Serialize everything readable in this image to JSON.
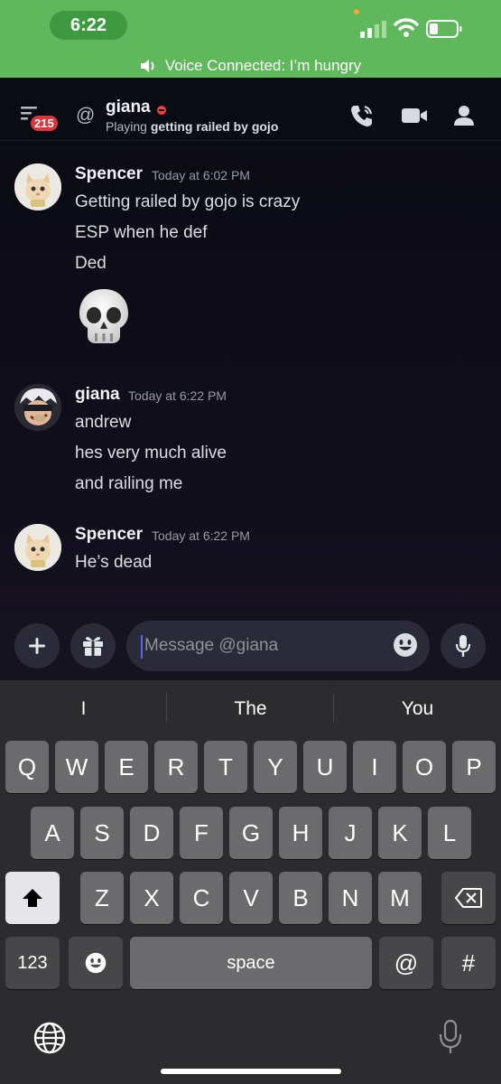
{
  "status_bar": {
    "time": "6:22",
    "voice_banner": "Voice Connected: I’m hungry"
  },
  "header": {
    "unread_badge": "215",
    "at_symbol": "@",
    "username": "giana",
    "status_prefix": "Playing",
    "status_game": "getting railed by gojo"
  },
  "messages": [
    {
      "author": "Spencer",
      "timestamp": "Today at 6:02 PM",
      "lines": [
        "Getting railed by gojo is crazy",
        "ESP when he def",
        "Ded"
      ],
      "emoji": "skull-emoji"
    },
    {
      "author": "giana",
      "timestamp": "Today at 6:22 PM",
      "lines": [
        "andrew",
        "hes very much alive",
        "and railing me"
      ]
    },
    {
      "author": "Spencer",
      "timestamp": "Today at 6:22 PM",
      "lines": [
        "He’s dead"
      ]
    }
  ],
  "composer": {
    "placeholder": "Message @giana"
  },
  "keyboard": {
    "suggestions": [
      "I",
      "The",
      "You"
    ],
    "row1": [
      "Q",
      "W",
      "E",
      "R",
      "T",
      "Y",
      "U",
      "I",
      "O",
      "P"
    ],
    "row2": [
      "A",
      "S",
      "D",
      "F",
      "G",
      "H",
      "J",
      "K",
      "L"
    ],
    "row3": [
      "Z",
      "X",
      "C",
      "V",
      "B",
      "N",
      "M"
    ],
    "numbers_label": "123",
    "space_label": "space",
    "at_label": "@",
    "hash_label": "#"
  },
  "colors": {
    "voice_banner": "#5fb85c",
    "background": "#0b0b14",
    "badge": "#da373c",
    "dnd_status": "#f23f43",
    "accent": "#5865f2"
  },
  "icons": [
    "menu-icon",
    "call-icon",
    "video-icon",
    "members-icon",
    "plus-icon",
    "gift-icon",
    "emoji-icon",
    "mic-icon",
    "shift-icon",
    "backspace-icon",
    "globe-icon",
    "speaker-icon"
  ]
}
